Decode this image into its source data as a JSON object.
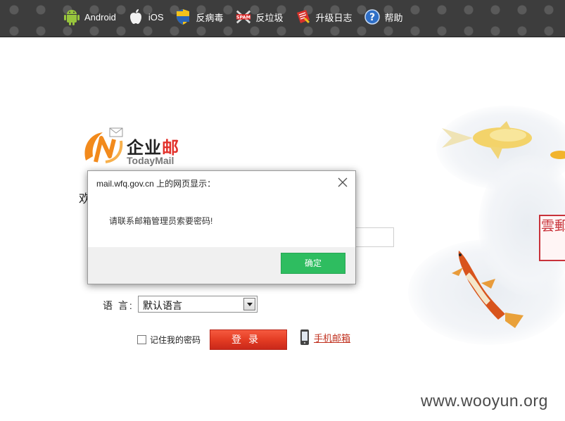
{
  "topnav": {
    "items": [
      {
        "label": "Android",
        "icon": "android-icon"
      },
      {
        "label": "iOS",
        "icon": "apple-icon"
      },
      {
        "label": "反病毒",
        "icon": "shield-icon"
      },
      {
        "label": "反垃圾",
        "icon": "spam-icon"
      },
      {
        "label": "升级日志",
        "icon": "upgrade-log-icon"
      },
      {
        "label": "帮助",
        "icon": "help-icon"
      }
    ]
  },
  "logo": {
    "title_a": "企业",
    "title_b": "邮",
    "subtitle": "TodayMail"
  },
  "welcome_char": "欢",
  "seal_text": "雲郵",
  "form": {
    "language_label": "语 言:",
    "language_value": "默认语言",
    "remember_label": "记住我的密码",
    "login_label": "登录",
    "mobile_label": "手机邮箱"
  },
  "dialog": {
    "title": "mail.wfq.gov.cn 上的网页显示：",
    "message": "请联系邮箱管理员索要密码!",
    "ok_label": "确定"
  },
  "watermark": "www.wooyun.org",
  "colors": {
    "accent_red": "#e2312b",
    "ok_green": "#2ebd60",
    "topbar": "#3d3d3d"
  }
}
